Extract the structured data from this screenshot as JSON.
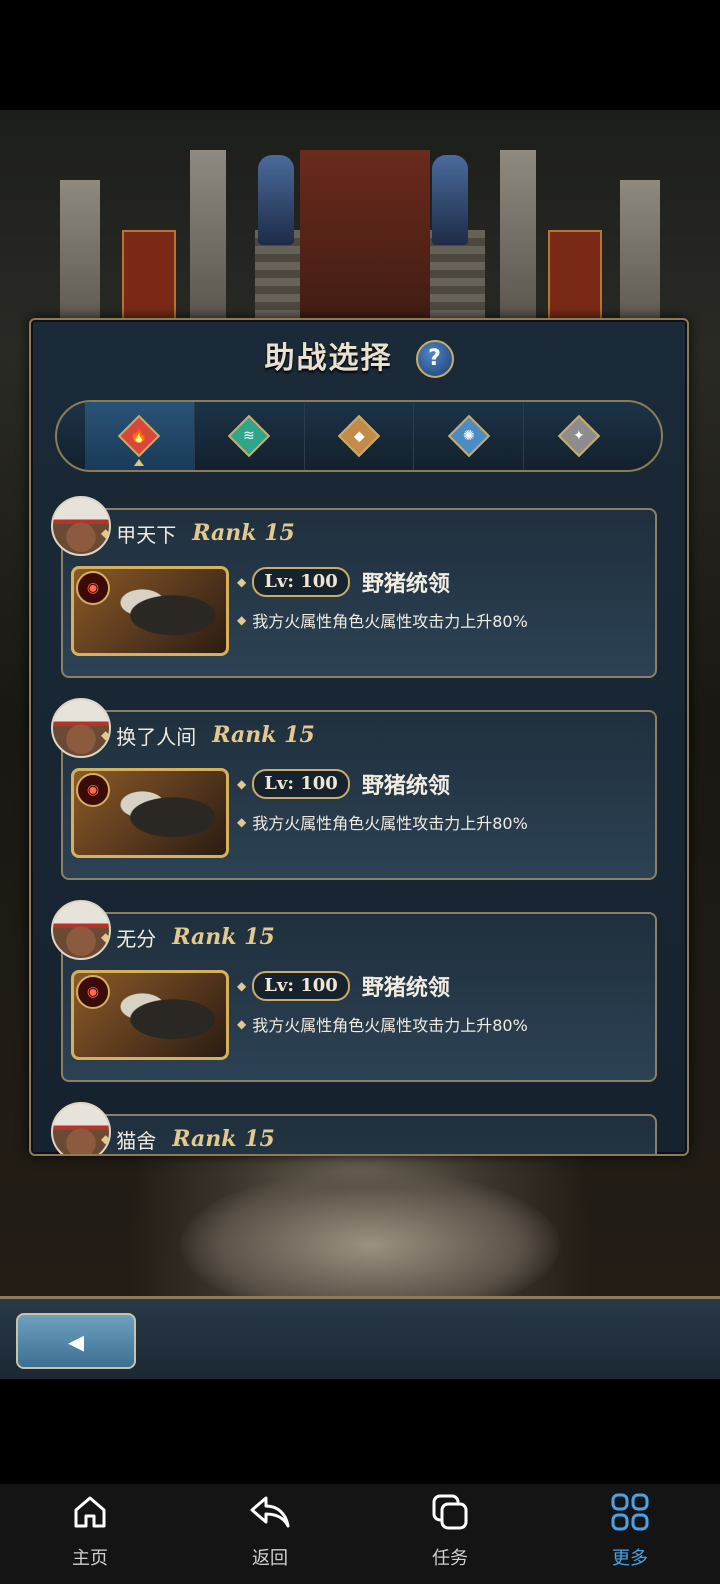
{
  "panel": {
    "title": "助战选择",
    "help_label": "?",
    "element_tabs": [
      {
        "name": "fire",
        "color": "#d8473a",
        "glyph": "🔥",
        "active": true
      },
      {
        "name": "water",
        "color": "#2fa68a",
        "glyph": "≋",
        "active": false
      },
      {
        "name": "earth",
        "color": "#c48a4a",
        "glyph": "◆",
        "active": false
      },
      {
        "name": "wind",
        "color": "#4b8cc5",
        "glyph": "✺",
        "active": false
      },
      {
        "name": "neutral",
        "color": "#8d8d8d",
        "glyph": "✦",
        "active": false
      }
    ]
  },
  "supports": [
    {
      "player": "甲天下",
      "rank": "Rank 15",
      "level": "Lv: 100",
      "summon": "野猪统领",
      "effect": "我方火属性角色火属性攻击力上升80%"
    },
    {
      "player": "换了人间",
      "rank": "Rank 15",
      "level": "Lv: 100",
      "summon": "野猪统领",
      "effect": "我方火属性角色火属性攻击力上升80%"
    },
    {
      "player": "无分",
      "rank": "Rank 15",
      "level": "Lv: 100",
      "summon": "野猪统领",
      "effect": "我方火属性角色火属性攻击力上升80%"
    },
    {
      "player": "猫舍",
      "rank": "Rank 15",
      "level": "",
      "summon": "",
      "effect": ""
    }
  ],
  "nav": [
    {
      "label": "主页",
      "icon": "home-icon",
      "active": false
    },
    {
      "label": "返回",
      "icon": "reply-icon",
      "active": false
    },
    {
      "label": "任务",
      "icon": "tasks-icon",
      "active": false
    },
    {
      "label": "更多",
      "icon": "grid-icon",
      "active": true
    }
  ],
  "colors": {
    "accent_gold": "#c9ac6a",
    "nav_active": "#4aa2e8"
  }
}
